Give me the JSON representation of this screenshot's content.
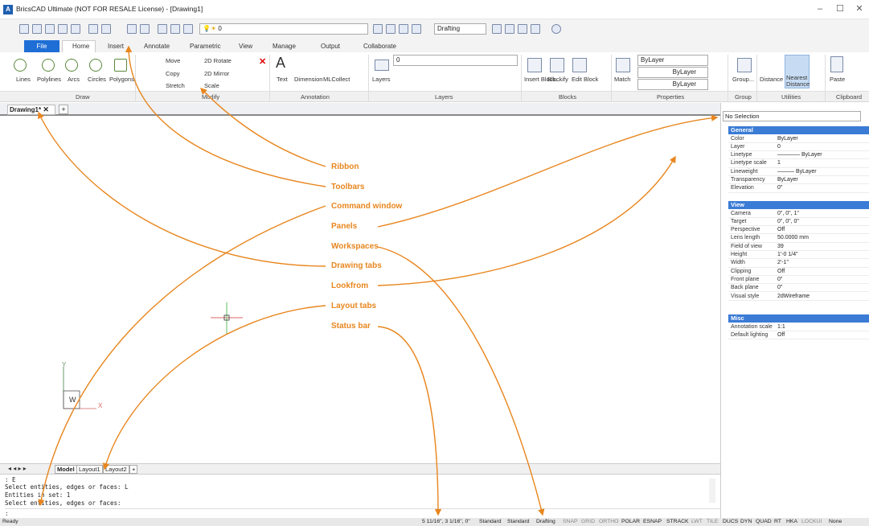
{
  "window": {
    "title": "BricsCAD Ultimate (NOT FOR RESALE License) - [Drawing1]",
    "app_icon": "A",
    "minimize": "–",
    "maximize": "☐",
    "close": "✕"
  },
  "toolbar": {
    "layer_value": "0",
    "workspace": "Drafting"
  },
  "ribbon": {
    "tabs": [
      "File",
      "Home",
      "Insert",
      "Annotate",
      "Parametric",
      "View",
      "Manage",
      "Output",
      "Collaborate"
    ],
    "draw_items": [
      "Lines",
      "Polylines",
      "Arcs",
      "Circles",
      "Polygons"
    ],
    "modify_items": [
      "Move",
      "2D Rotate",
      "Copy",
      "2D Mirror",
      "Stretch",
      "Scale"
    ],
    "annotation_items": [
      "Text",
      "Dimension",
      "MLCollect"
    ],
    "layers_label": "Layers",
    "layer_value": "0",
    "block_items": [
      "Insert Block...",
      "Blockify",
      "Edit Block"
    ],
    "match_label": "Match",
    "bylayer": "ByLayer",
    "group_label": "Group...",
    "utilities_items": [
      "Distance",
      "Nearest Distance"
    ],
    "paste_label": "Paste",
    "panels": [
      "Draw",
      "Modify",
      "Annotation",
      "Layers",
      "Blocks",
      "Properties",
      "Group",
      "Utilities",
      "Clipboard"
    ]
  },
  "drawing_tab": "Drawing1*",
  "ucs": {
    "y": "Y",
    "x": "X",
    "w": "W"
  },
  "layout_tabs": [
    "Model",
    "Layout1",
    "Layout2",
    "+"
  ],
  "command_history": [
    ": E",
    "Select entities, edges or faces: L",
    "Entities in set: 1",
    "Select entities, edges or faces:"
  ],
  "command_prompt": ":",
  "status": {
    "left": "Ready",
    "coords": "5 11/16\", 3 1/16\", 0\"",
    "items": [
      "Standard",
      "Standard",
      "Drafting",
      "SNAP",
      "GRID",
      "ORTHO",
      "POLAR",
      "ESNAP",
      "STRACK",
      "LWT",
      "TILE",
      "DUCS",
      "DYN",
      "QUAD",
      "RT",
      "HKA",
      "LOCKUI",
      "None"
    ]
  },
  "properties": {
    "selection": "No Selection",
    "general_title": "General",
    "general": [
      [
        "Color",
        "ByLayer"
      ],
      [
        "Layer",
        "0"
      ],
      [
        "Linetype",
        "———— ByLayer"
      ],
      [
        "Linetype scale",
        "1"
      ],
      [
        "Lineweight",
        "——— ByLayer"
      ],
      [
        "Transparency",
        "ByLayer"
      ],
      [
        "Elevation",
        "0\""
      ]
    ],
    "view_title": "View",
    "view": [
      [
        "Camera",
        "0\", 0\", 1\""
      ],
      [
        "Target",
        "0\", 0\", 0\""
      ],
      [
        "Perspective",
        "Off"
      ],
      [
        "Lens length",
        "50.0000 mm"
      ],
      [
        "Field of view",
        "39"
      ],
      [
        "Height",
        "1'-0 1/4\""
      ],
      [
        "Width",
        "2'-1\""
      ],
      [
        "Clipping",
        "Off"
      ],
      [
        "Front plane",
        "0\""
      ],
      [
        "Back plane",
        "0\""
      ],
      [
        "Visual style",
        "2dWireframe"
      ]
    ],
    "misc_title": "Misc",
    "misc": [
      [
        "Annotation scale",
        "1:1"
      ],
      [
        "Default lighting",
        "Off"
      ]
    ]
  },
  "annotations": [
    "Ribbon",
    "Toolbars",
    "Command window",
    "Panels",
    "Workspaces",
    "Drawing tabs",
    "Lookfrom",
    "Layout tabs",
    "Status bar"
  ],
  "colors": {
    "accent": "#1e6ed6",
    "annotation": "#e8861e",
    "prop_header": "#3a7bd5"
  }
}
